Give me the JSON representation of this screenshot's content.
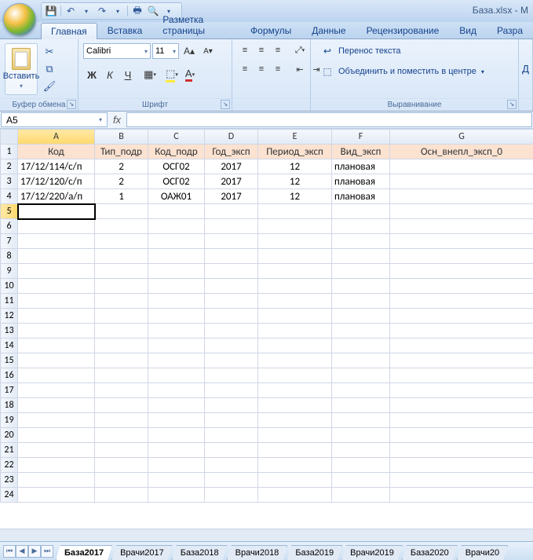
{
  "app": {
    "title": "База.xlsx - M"
  },
  "qat": {
    "save": "save",
    "undo": "undo",
    "redo": "redo",
    "print": "print",
    "preview": "preview"
  },
  "tabs": {
    "items": [
      "Главная",
      "Вставка",
      "Разметка страницы",
      "Формулы",
      "Данные",
      "Рецензирование",
      "Вид",
      "Разра"
    ],
    "active": 0
  },
  "ribbon": {
    "clipboard": {
      "paste": "Вставить",
      "label": "Буфер обмена"
    },
    "font": {
      "name": "Calibri",
      "size": "11",
      "label": "Шрифт",
      "bold": "Ж",
      "italic": "К",
      "underline": "Ч"
    },
    "alignment": {
      "label": "Выравнивание"
    },
    "wrap": {
      "wrap_label": "Перенос текста",
      "merge_label": "Объединить и поместить в центре"
    },
    "far_label": "Д"
  },
  "namebox": {
    "ref": "A5"
  },
  "formula_bar": {
    "fx": "fx",
    "value": ""
  },
  "columns": [
    "A",
    "B",
    "C",
    "D",
    "E",
    "F",
    "G"
  ],
  "headers": [
    "Код",
    "Тип_подр",
    "Код_подр",
    "Год_эксп",
    "Период_эксп",
    "Вид_эксп",
    "Осн_внепл_эксп_0"
  ],
  "rows": [
    {
      "A": "17/12/114/с/п",
      "B": "2",
      "C": "ОСГ02",
      "D": "2017",
      "E": "12",
      "F": "плановая",
      "G": ""
    },
    {
      "A": "17/12/120/с/п",
      "B": "2",
      "C": "ОСГ02",
      "D": "2017",
      "E": "12",
      "F": "плановая",
      "G": ""
    },
    {
      "A": "17/12/220/а/п",
      "B": "1",
      "C": "ОАЖ01",
      "D": "2017",
      "E": "12",
      "F": "плановая",
      "G": ""
    }
  ],
  "row_count": 24,
  "selected_cell": {
    "col": "A",
    "row": 5
  },
  "sheet_tabs": {
    "items": [
      "База2017",
      "Врачи2017",
      "База2018",
      "Врачи2018",
      "База2019",
      "Врачи2019",
      "База2020",
      "Врачи20"
    ],
    "active": 0
  }
}
